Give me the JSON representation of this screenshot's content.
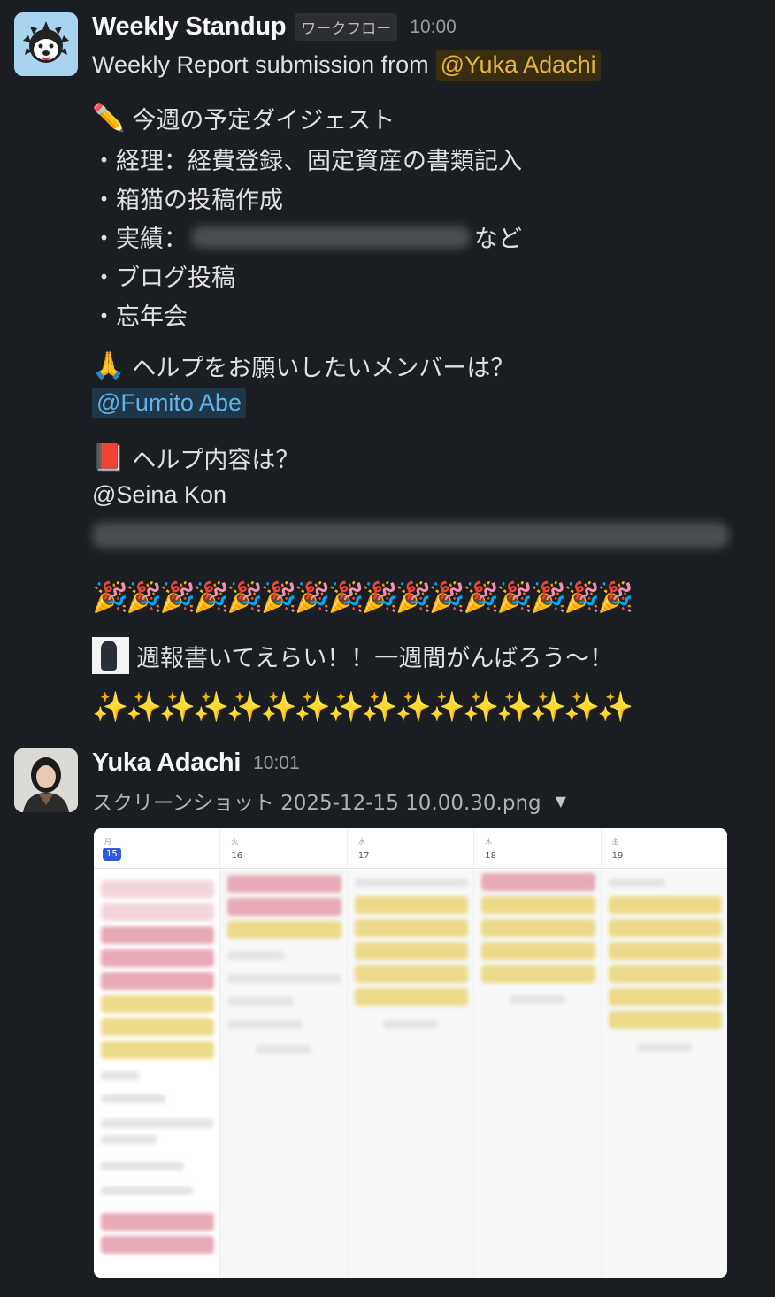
{
  "bot_message": {
    "sender": "Weekly Standup",
    "badge": "ワークフロー",
    "time": "10:00",
    "subtitle_text": "Weekly Report submission from",
    "subtitle_mention": "@Yuka Adachi",
    "section1": {
      "icon": "pencil-icon",
      "title": "今週の予定ダイジェスト",
      "items": [
        "・経理：経費登録、固定資産の書類記入",
        "・箱猫の投稿作成",
        "・実績：",
        "・ブログ投稿",
        "・忘年会"
      ],
      "item3_suffix": "など"
    },
    "section2": {
      "icon": "folded-hands-icon",
      "title": "ヘルプをお願いしたいメンバーは？",
      "mention": "@Fumito Abe"
    },
    "section3": {
      "icon": "red-book-icon",
      "title": "ヘルプ内容は？",
      "mention": "@Seina Kon"
    },
    "party_row": "🎉🎉🎉🎉🎉🎉🎉🎉🎉🎉🎉🎉🎉🎉🎉🎉",
    "cheer_text": "週報書いてえらい！！一週間がんばろう〜！",
    "sparkle_row": "✨✨✨✨✨✨✨✨✨✨✨✨✨✨✨✨"
  },
  "user_message": {
    "sender": "Yuka Adachi",
    "time": "10:01",
    "file_name": "スクリーンショット 2025-12-15 10.00.30.png",
    "calendar": {
      "days": [
        {
          "weekday": "月",
          "date": "15",
          "today": true
        },
        {
          "weekday": "火",
          "date": "16",
          "today": false
        },
        {
          "weekday": "水",
          "date": "17",
          "today": false
        },
        {
          "weekday": "木",
          "date": "18",
          "today": false
        },
        {
          "weekday": "金",
          "date": "19",
          "today": false
        }
      ]
    }
  },
  "colors": {
    "background": "#1a1d21",
    "mention_yellow": "#e7b53a",
    "mention_blue": "#5fb4e8",
    "today_blue": "#2e5bdb"
  }
}
